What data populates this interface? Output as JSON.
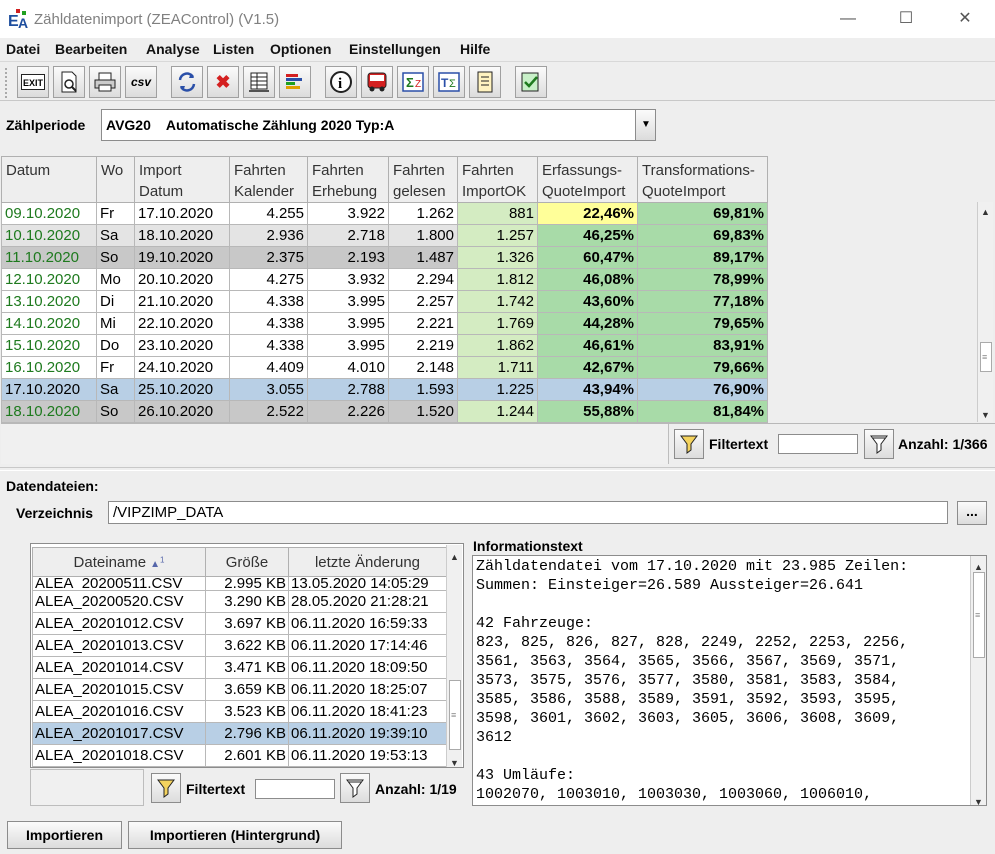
{
  "window": {
    "title": "Zähldatenimport (ZEAControl) (V1.5)"
  },
  "menu": [
    "Datei",
    "Bearbeiten",
    "Analyse",
    "Listen",
    "Optionen",
    "Einstellungen",
    "Hilfe"
  ],
  "toolbar": {
    "buttons": [
      "exit-icon",
      "print-preview-icon",
      "print-icon",
      "csv-export-icon",
      "refresh-icon",
      "delete-icon",
      "table-icon",
      "bar-chart-icon",
      "info-icon",
      "bus-icon",
      "sum-icon",
      "transform-sum-icon",
      "list-icon",
      "check-icon"
    ],
    "csv_label": "csv",
    "exit_label": "EXIT"
  },
  "zaehlperiode": {
    "label": "Zählperiode",
    "value": "AVG20    Automatische Zählung 2020 Typ:A"
  },
  "top_table": {
    "headers": [
      [
        "Datum",
        ""
      ],
      [
        "Wo",
        ""
      ],
      [
        "Import",
        "Datum"
      ],
      [
        "Fahrten",
        "Kalender"
      ],
      [
        "Fahrten",
        "Erhebung"
      ],
      [
        "Fahrten",
        "gelesen"
      ],
      [
        "Fahrten",
        "ImportOK"
      ],
      [
        "Erfassungs-",
        "QuoteImport"
      ],
      [
        "Transformations-",
        "QuoteImport"
      ]
    ],
    "rows": [
      [
        "09.10.2020",
        "Fr",
        "17.10.2020",
        "4.255",
        "3.922",
        "1.262",
        "881",
        "22,46%",
        "69,81%"
      ],
      [
        "10.10.2020",
        "Sa",
        "18.10.2020",
        "2.936",
        "2.718",
        "1.800",
        "1.257",
        "46,25%",
        "69,83%"
      ],
      [
        "11.10.2020",
        "So",
        "19.10.2020",
        "2.375",
        "2.193",
        "1.487",
        "1.326",
        "60,47%",
        "89,17%"
      ],
      [
        "12.10.2020",
        "Mo",
        "20.10.2020",
        "4.275",
        "3.932",
        "2.294",
        "1.812",
        "46,08%",
        "78,99%"
      ],
      [
        "13.10.2020",
        "Di",
        "21.10.2020",
        "4.338",
        "3.995",
        "2.257",
        "1.742",
        "43,60%",
        "77,18%"
      ],
      [
        "14.10.2020",
        "Mi",
        "22.10.2020",
        "4.338",
        "3.995",
        "2.221",
        "1.769",
        "44,28%",
        "79,65%"
      ],
      [
        "15.10.2020",
        "Do",
        "23.10.2020",
        "4.338",
        "3.995",
        "2.219",
        "1.862",
        "46,61%",
        "83,91%"
      ],
      [
        "16.10.2020",
        "Fr",
        "24.10.2020",
        "4.409",
        "4.010",
        "2.148",
        "1.711",
        "42,67%",
        "79,66%"
      ],
      [
        "17.10.2020",
        "Sa",
        "25.10.2020",
        "3.055",
        "2.788",
        "1.593",
        "1.225",
        "43,94%",
        "76,90%"
      ],
      [
        "18.10.2020",
        "So",
        "26.10.2020",
        "2.522",
        "2.226",
        "1.520",
        "1.244",
        "55,88%",
        "81,84%"
      ]
    ],
    "row_types": [
      "normal",
      "sat",
      "sun",
      "normal",
      "normal",
      "normal",
      "normal",
      "normal",
      "selected",
      "sun"
    ],
    "filter_label": "Filtertext",
    "filter_value": "",
    "count": "Anzahl: 1/366"
  },
  "datendateien": {
    "label": "Datendateien:",
    "verzeichnis_label": "Verzeichnis",
    "verzeichnis_value": "/VIPZIMP_DATA",
    "browse_label": "...",
    "headers": [
      "Dateiname",
      "Größe",
      "letzte Änderung"
    ],
    "sort_indicator": "1",
    "files": [
      [
        "ALEA_20200511.CSV",
        "2.995 KB",
        "13.05.2020 14:05:29"
      ],
      [
        "ALEA_20200520.CSV",
        "3.290 KB",
        "28.05.2020 21:28:21"
      ],
      [
        "ALEA_20201012.CSV",
        "3.697 KB",
        "06.11.2020 16:59:33"
      ],
      [
        "ALEA_20201013.CSV",
        "3.622 KB",
        "06.11.2020 17:14:46"
      ],
      [
        "ALEA_20201014.CSV",
        "3.471 KB",
        "06.11.2020 18:09:50"
      ],
      [
        "ALEA_20201015.CSV",
        "3.659 KB",
        "06.11.2020 18:25:07"
      ],
      [
        "ALEA_20201016.CSV",
        "3.523 KB",
        "06.11.2020 18:41:23"
      ],
      [
        "ALEA_20201017.CSV",
        "2.796 KB",
        "06.11.2020 19:39:10"
      ],
      [
        "ALEA_20201018.CSV",
        "2.601 KB",
        "06.11.2020 19:53:13"
      ]
    ],
    "selected_index": 7,
    "filter_label": "Filtertext",
    "filter_value": "",
    "count": "Anzahl: 1/19"
  },
  "info": {
    "label": "Informationstext",
    "text": "Zähldatendatei vom 17.10.2020 mit 23.985 Zeilen:\nSummen: Einsteiger=26.589 Aussteiger=26.641\n\n42 Fahrzeuge:\n823, 825, 826, 827, 828, 2249, 2252, 2253, 2256,\n3561, 3563, 3564, 3565, 3566, 3567, 3569, 3571,\n3573, 3575, 3576, 3577, 3580, 3581, 3583, 3584,\n3585, 3586, 3588, 3589, 3591, 3592, 3593, 3595,\n3598, 3601, 3602, 3603, 3605, 3606, 3608, 3609,\n3612\n\n43 Umläufe:\n1002070, 1003010, 1003030, 1003060, 1006010,"
  },
  "buttons": {
    "import": "Importieren",
    "import_bg": "Importieren (Hintergrund)"
  },
  "colors": {
    "col_importok": "#d4ecc2",
    "col_quote": "#a8dba8",
    "low_quote": "#ffff99",
    "selected": "#b8cfe5",
    "sunday": "#c8c8c8",
    "saturday": "#e4e4e4",
    "date_green": "#1e7a1e"
  }
}
